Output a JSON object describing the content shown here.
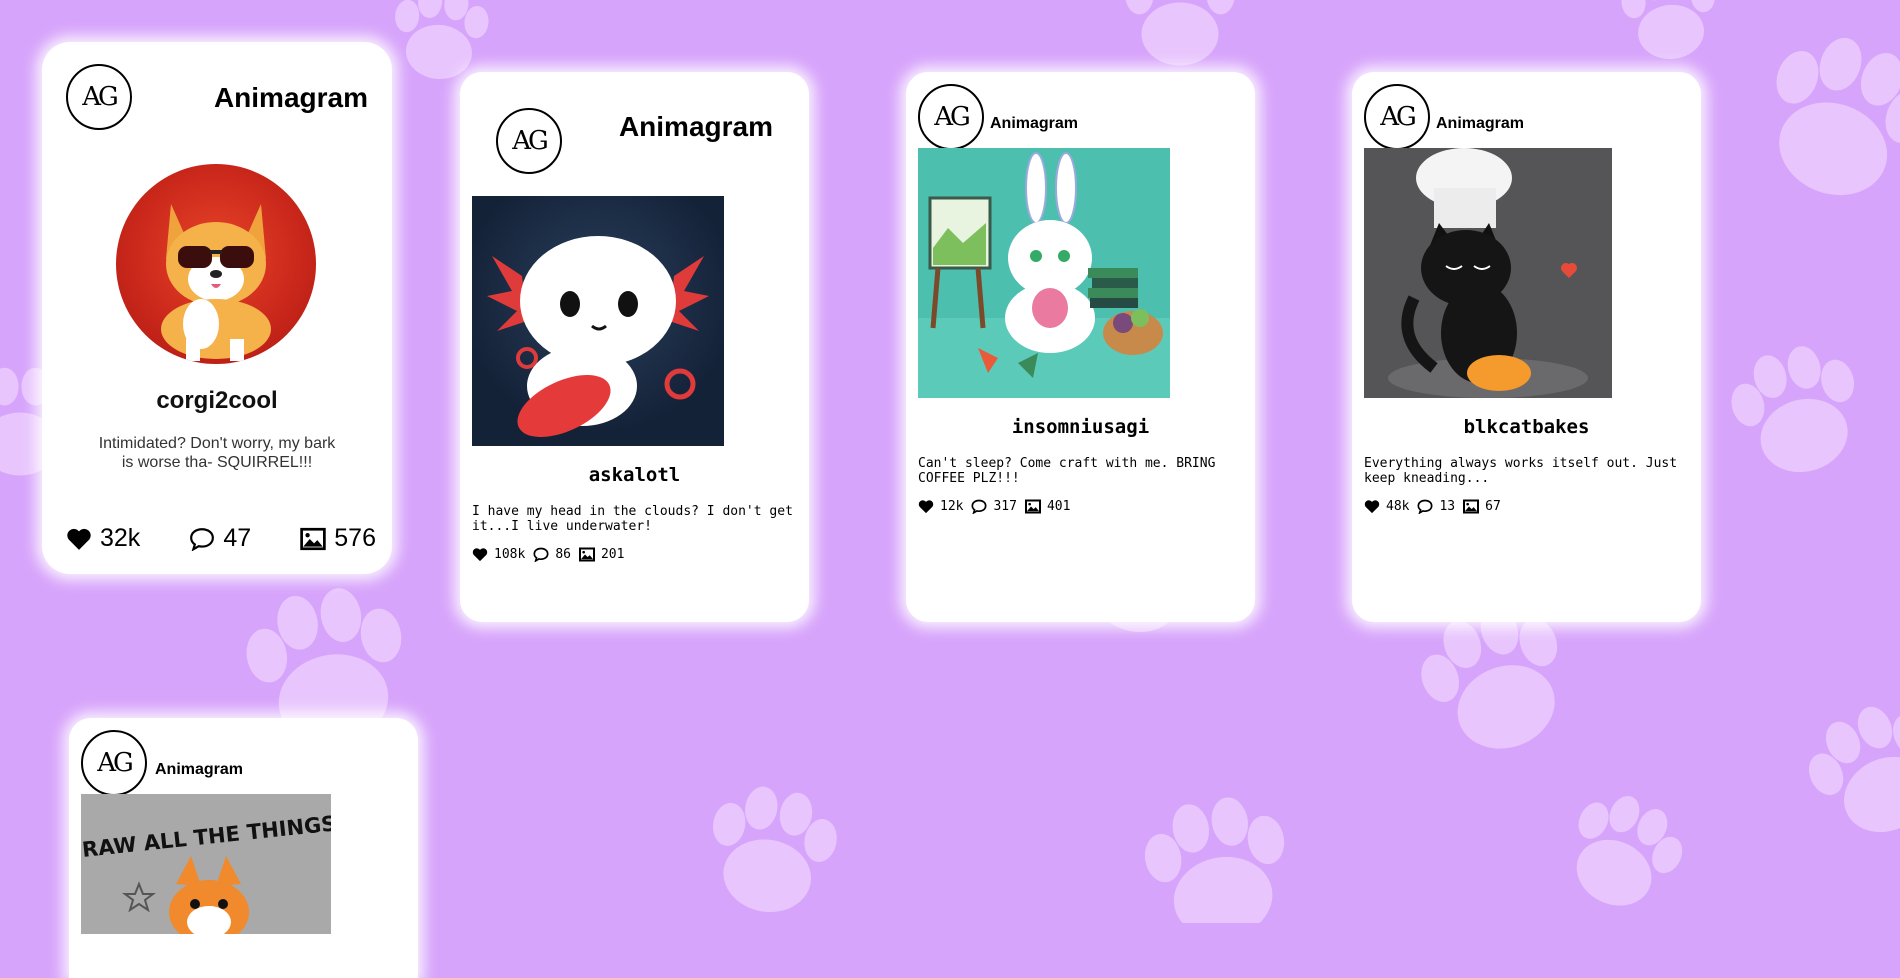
{
  "brand": "Animagram",
  "logo_text": "AG",
  "colors": {
    "background": "#d7a4fb",
    "paw": "#e8c6fd",
    "card": "#ffffff"
  },
  "cards": [
    {
      "username": "corgi2cool",
      "bio": "Intimidated? Don't worry, my bark is worse tha- SQUIRREL!!!",
      "likes": "32k",
      "comments": "47",
      "posts": "576",
      "image": "corgi-with-sunglasses"
    },
    {
      "username": "askalotl",
      "bio": "I have my head in the clouds? I don't get it...I live underwater!",
      "likes": "108k",
      "comments": "86",
      "posts": "201",
      "image": "axolotl-swimming"
    },
    {
      "username": "insomniusagi",
      "bio": "Can't sleep? Come craft with me. BRING COFFEE PLZ!!!",
      "likes": "12k",
      "comments": "317",
      "posts": "401",
      "image": "bunny-crafting"
    },
    {
      "username": "blkcatbakes",
      "bio": "Everything always works itself out. Just keep kneading...",
      "likes": "48k",
      "comments": "13",
      "posts": "67",
      "image": "black-cat-chef"
    },
    {
      "image_caption": "DRAW ALL THE THINGS!",
      "image": "fox-drawing"
    }
  ]
}
